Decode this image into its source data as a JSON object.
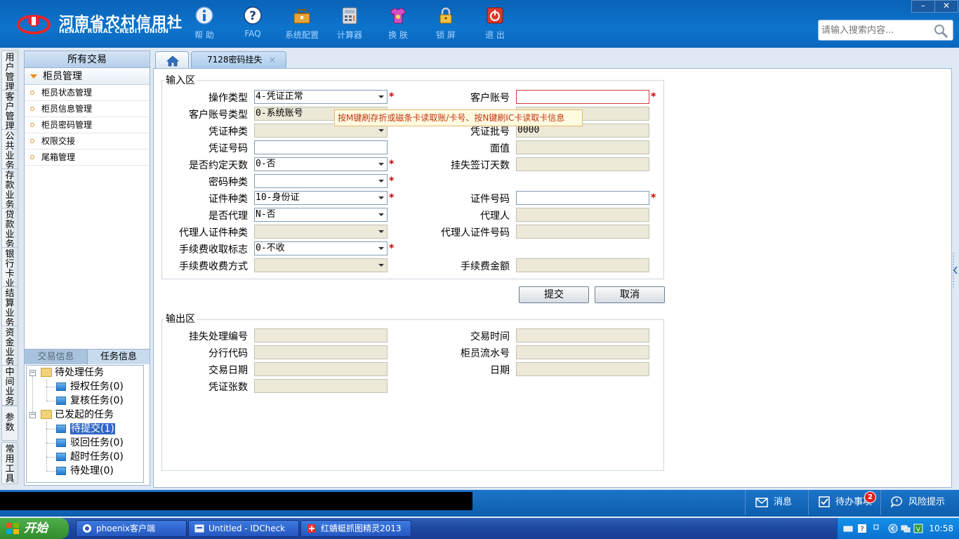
{
  "header": {
    "logo_cn": "河南省农村信用社",
    "logo_en": "HENAN RURAL CREDIT UNION",
    "tools": [
      {
        "label": "帮 助",
        "icon": "info-icon"
      },
      {
        "label": "FAQ",
        "icon": "question-icon"
      },
      {
        "label": "系统配置",
        "icon": "toolbox-icon"
      },
      {
        "label": "计算器",
        "icon": "calculator-icon"
      },
      {
        "label": "换 肤",
        "icon": "shirt-icon"
      },
      {
        "label": "锁 屏",
        "icon": "lock-icon"
      },
      {
        "label": "退 出",
        "icon": "power-icon"
      }
    ],
    "win_min": "–",
    "win_close": "✕",
    "search_placeholder": "请输入搜索内容..."
  },
  "vnav": [
    "用户管理",
    "客户管理",
    "公共业务",
    "存款业务",
    "贷款业务",
    "银行卡业务",
    "结算业务",
    "资金业务",
    "中间业务",
    "参数",
    "常用工具"
  ],
  "leftpanel": {
    "header": "所有交易",
    "group": "柜员管理",
    "items": [
      "柜员状态管理",
      "柜员信息管理",
      "柜员密码管理",
      "权限交接",
      "尾箱管理"
    ],
    "tab_txn_info": "交易信息",
    "tab_task_info": "任务信息",
    "tree": {
      "pending_root": "待处理任务",
      "auth_task": "授权任务(0)",
      "review_task": "复核任务(0)",
      "initiated_root": "已发起的任务",
      "to_submit": "待提交(1)",
      "rejected": "驳回任务(0)",
      "timeout": "超时任务(0)",
      "to_process": "待处理(0)"
    }
  },
  "tabs": {
    "txn_tab": "7128密码挂失",
    "close": "×"
  },
  "input_area": {
    "legend": "输入区",
    "tooltip": "按M键刷存折或磁条卡读取账/卡号、按N键刷IC卡读取卡信息",
    "left": [
      {
        "label": "操作类型",
        "value": "4-凭证正常",
        "required": true
      },
      {
        "label": "客户账号类型",
        "value": "0-系统账号",
        "required": false
      },
      {
        "label": "凭证种类",
        "value": "",
        "required": false
      },
      {
        "label": "凭证号码",
        "value": "",
        "required": false
      },
      {
        "label": "是否约定天数",
        "value": "0-否",
        "required": true
      },
      {
        "label": "密码种类",
        "value": "",
        "required": true
      },
      {
        "label": "证件种类",
        "value": "10-身份证",
        "required": true
      },
      {
        "label": "是否代理",
        "value": "N-否",
        "required": false
      },
      {
        "label": "代理人证件种类",
        "value": "",
        "required": false
      },
      {
        "label": "手续费收取标志",
        "value": "0-不收",
        "required": true
      },
      {
        "label": "手续费收费方式",
        "value": "",
        "required": false
      }
    ],
    "right": [
      {
        "label": "客户账号",
        "value": "",
        "required": true
      },
      {
        "label": "凭证批号",
        "value": "0000",
        "required": false
      },
      {
        "label": "面值",
        "value": "",
        "required": false
      },
      {
        "label": "挂失签订天数",
        "value": "",
        "required": false
      },
      {
        "label": "证件号码",
        "value": "",
        "required": true
      },
      {
        "label": "代理人",
        "value": "",
        "required": false
      },
      {
        "label": "代理人证件号码",
        "value": "",
        "required": false
      },
      {
        "label": "手续费金额",
        "value": "",
        "required": false
      }
    ],
    "submit": "提交",
    "cancel": "取消"
  },
  "output_area": {
    "legend": "输出区",
    "left": [
      {
        "label": "挂失处理编号",
        "value": ""
      },
      {
        "label": "分行代码",
        "value": ""
      },
      {
        "label": "交易日期",
        "value": ""
      },
      {
        "label": "凭证张数",
        "value": ""
      }
    ],
    "right": [
      {
        "label": "交易时间",
        "value": ""
      },
      {
        "label": "柜员流水号",
        "value": ""
      },
      {
        "label": "日期",
        "value": ""
      }
    ]
  },
  "statusbar": {
    "messages": "消息",
    "todo": "待办事项",
    "todo_count": "2",
    "risk": "风险提示"
  },
  "taskbar": {
    "start": "开始",
    "tasks": [
      "phoenix客户端",
      "Untitled - IDCheck",
      "红蜻蜓抓图精灵2013"
    ],
    "clock": "10:58"
  },
  "colors": {
    "header_blue": "#0d74cc",
    "required_star": "#cc0000",
    "tooltip_text": "#c0330f",
    "selected_node": "#3168c5"
  }
}
